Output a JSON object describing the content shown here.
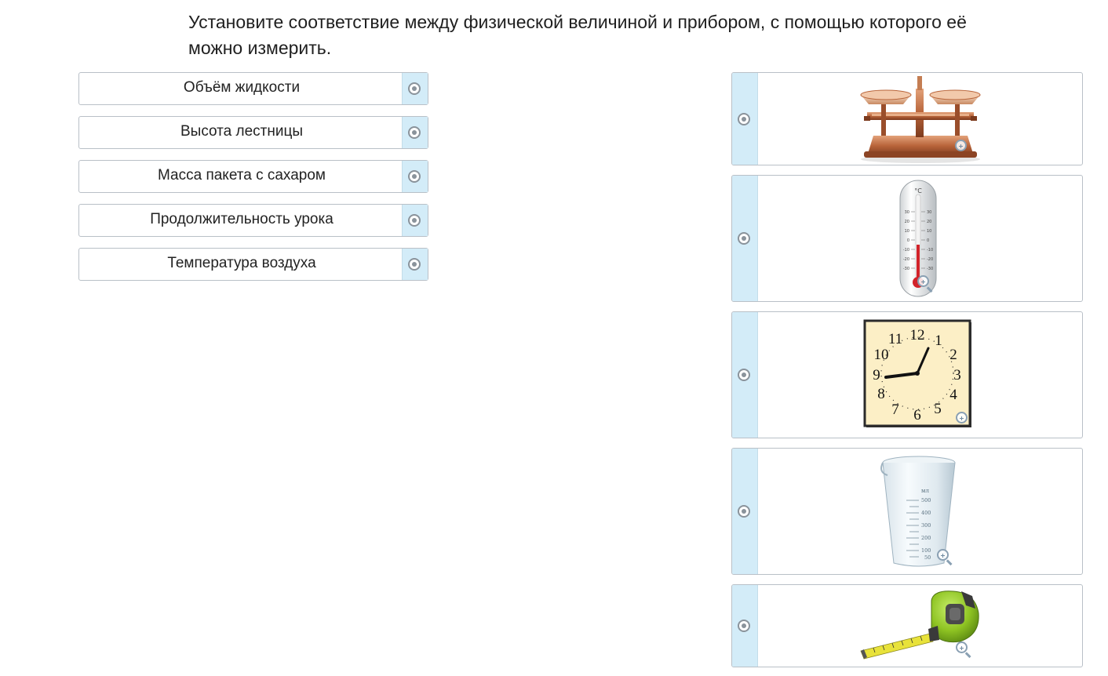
{
  "question": "Установите соответствие между физической величиной и прибором, с помощью которого её можно измерить.",
  "left_items": [
    {
      "label": "Объём жидкости"
    },
    {
      "label": "Высота лестницы"
    },
    {
      "label": "Масса пакета с сахаром"
    },
    {
      "label": "Продолжительность урока"
    },
    {
      "label": "Температура воздуха"
    }
  ],
  "right_items": [
    {
      "icon": "balance-scale"
    },
    {
      "icon": "thermometer"
    },
    {
      "icon": "wall-clock"
    },
    {
      "icon": "measuring-beaker"
    },
    {
      "icon": "tape-measure"
    }
  ],
  "thermometer": {
    "unit": "°C",
    "ticks": [
      "30",
      "20",
      "10",
      "0",
      "-10",
      "-20",
      "-30"
    ]
  },
  "clock": {
    "numbers": [
      "12",
      "1",
      "2",
      "3",
      "4",
      "5",
      "6",
      "7",
      "8",
      "9",
      "10",
      "11"
    ]
  },
  "beaker": {
    "unit": "мл",
    "ticks": [
      "500",
      "400",
      "300",
      "200",
      "100",
      "50"
    ]
  },
  "colors": {
    "handle": "#d3ecf8",
    "border": "#b9c0c7",
    "radio": "#8a939b"
  }
}
